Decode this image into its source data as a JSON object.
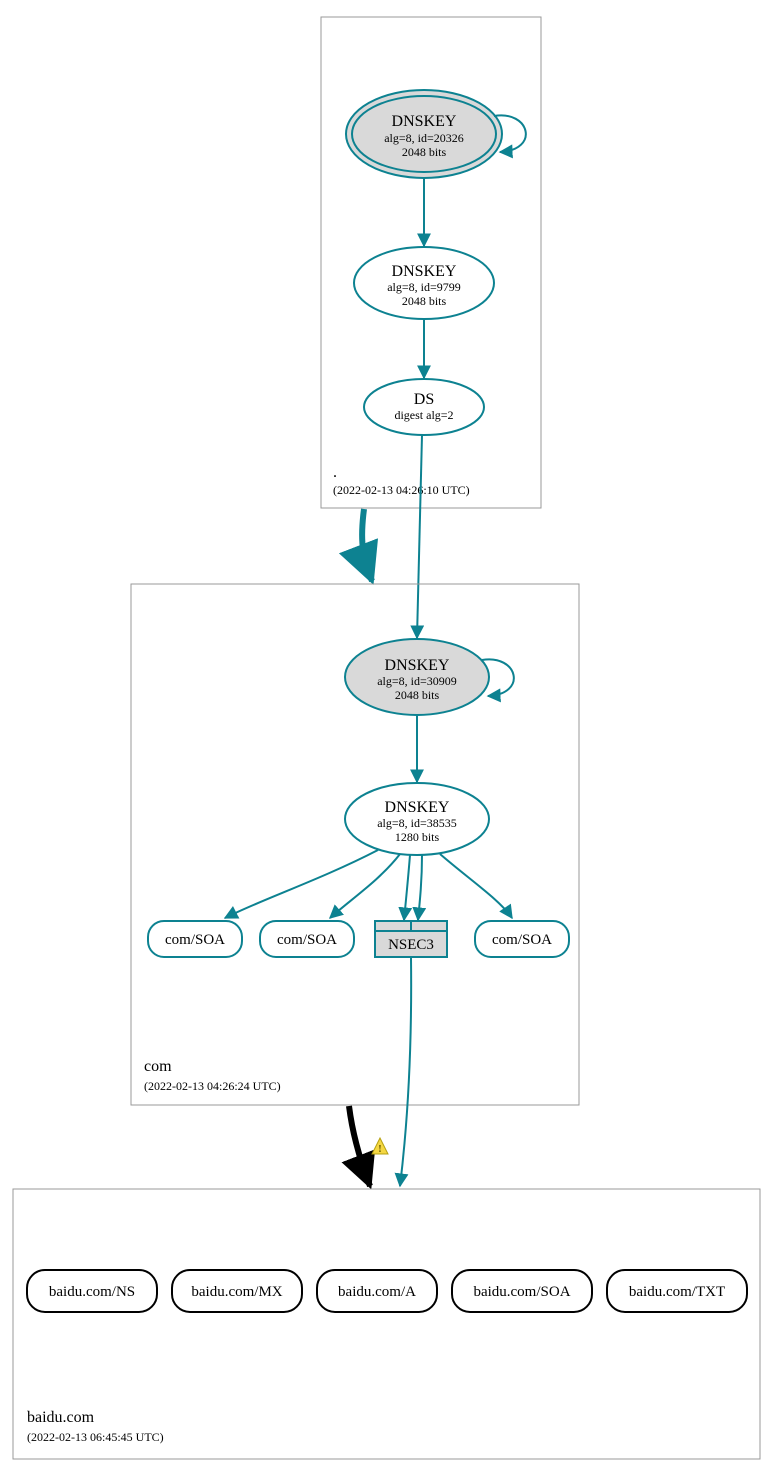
{
  "zones": {
    "root": {
      "label": ".",
      "timestamp": "(2022-02-13 04:26:10 UTC)"
    },
    "com": {
      "label": "com",
      "timestamp": "(2022-02-13 04:26:24 UTC)"
    },
    "baidu": {
      "label": "baidu.com",
      "timestamp": "(2022-02-13 06:45:45 UTC)"
    }
  },
  "nodes": {
    "root_ksk": {
      "title": "DNSKEY",
      "line1": "alg=8, id=20326",
      "line2": "2048 bits"
    },
    "root_zsk": {
      "title": "DNSKEY",
      "line1": "alg=8, id=9799",
      "line2": "2048 bits"
    },
    "root_ds": {
      "title": "DS",
      "line1": "digest alg=2"
    },
    "com_ksk": {
      "title": "DNSKEY",
      "line1": "alg=8, id=30909",
      "line2": "2048 bits"
    },
    "com_zsk": {
      "title": "DNSKEY",
      "line1": "alg=8, id=38535",
      "line2": "1280 bits"
    },
    "com_soa1": {
      "label": "com/SOA"
    },
    "com_soa2": {
      "label": "com/SOA"
    },
    "com_nsec3": {
      "label": "NSEC3"
    },
    "com_soa3": {
      "label": "com/SOA"
    },
    "baidu_ns": {
      "label": "baidu.com/NS"
    },
    "baidu_mx": {
      "label": "baidu.com/MX"
    },
    "baidu_a": {
      "label": "baidu.com/A"
    },
    "baidu_soa": {
      "label": "baidu.com/SOA"
    },
    "baidu_txt": {
      "label": "baidu.com/TXT"
    }
  }
}
